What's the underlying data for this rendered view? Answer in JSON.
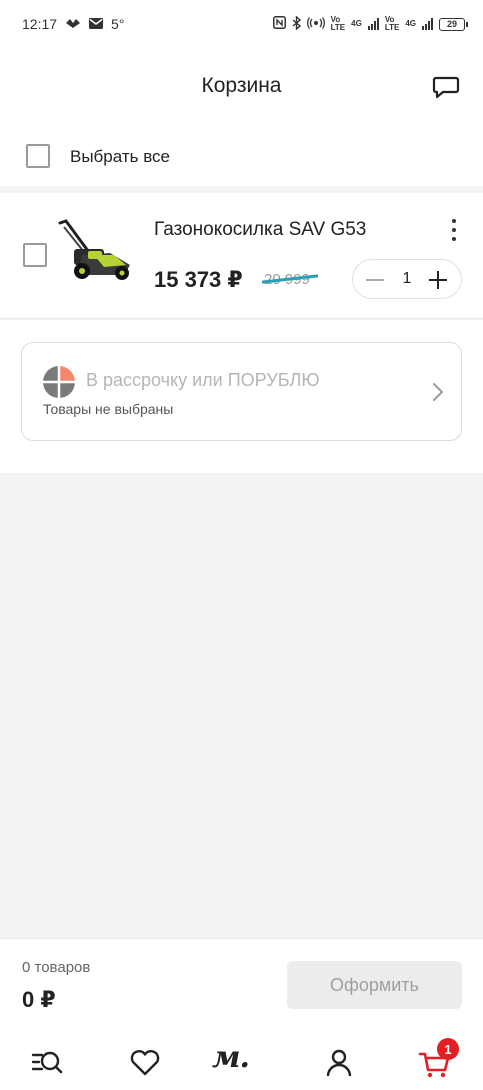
{
  "status_bar": {
    "time": "12:17",
    "temp": "5°",
    "net1_top": "Vo",
    "net1_bottom": "LTE",
    "net2": "4G",
    "net3_top": "Vo",
    "net3_bottom": "LTE",
    "net4": "4G",
    "battery": "29"
  },
  "header": {
    "title": "Корзина"
  },
  "select_all": {
    "label": "Выбрать все"
  },
  "item": {
    "title": "Газонокосилка SAV G53",
    "price": "15 373 ₽",
    "old_price": "20 999",
    "quantity": "1"
  },
  "installment": {
    "title": "В рассрочку или ПОРУБЛЮ",
    "subtitle": "Товары не выбраны"
  },
  "footer": {
    "count": "0 товаров",
    "total": "0 ₽",
    "checkout_label": "Оформить"
  },
  "bottom_nav": {
    "logo": "м.",
    "cart_badge": "1"
  },
  "colors": {
    "accent": "#e31e24",
    "strike": "#2a9fb8",
    "installment_orange": "#f4866d",
    "installment_gray": "#7a7a7a",
    "mower_green": "#b5d335"
  }
}
